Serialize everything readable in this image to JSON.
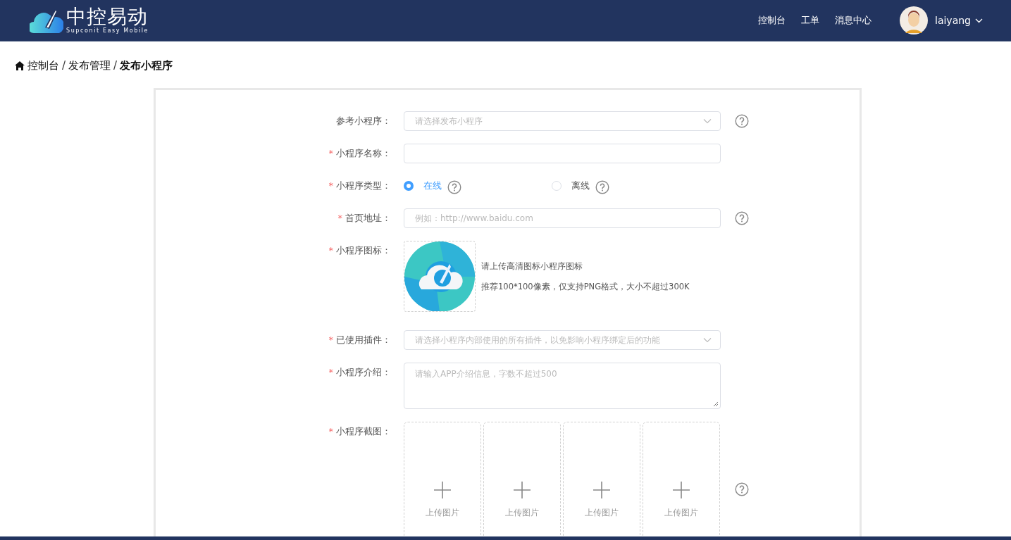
{
  "header": {
    "logo": {
      "title": "中控易动",
      "subtitle": "Supconit Easy Mobile"
    },
    "nav": [
      {
        "label": "控制台"
      },
      {
        "label": "工单"
      },
      {
        "label": "消息中心"
      }
    ],
    "user": {
      "name": "laiyang"
    }
  },
  "breadcrumb_separator": "/",
  "breadcrumb": [
    {
      "label": "控制台",
      "current": false
    },
    {
      "label": "发布管理",
      "current": false
    },
    {
      "label": "发布小程序",
      "current": true
    }
  ],
  "form": {
    "required_mark": "*",
    "fields": [
      {
        "kind": "select",
        "label": "参考小程序：",
        "required": false,
        "placeholder": "请选择发布小程序",
        "help": true
      },
      {
        "kind": "input",
        "label": "小程序名称：",
        "required": true,
        "help": false
      },
      {
        "kind": "radio",
        "label": "小程序类型：",
        "required": true,
        "options": [
          {
            "label": "在线",
            "selected": true,
            "help": true
          },
          {
            "label": "离线",
            "selected": false,
            "help": true
          }
        ]
      },
      {
        "kind": "input",
        "label": "首页地址：",
        "required": true,
        "placeholder": "例如：http://www.baidu.com",
        "help": true
      },
      {
        "kind": "icon",
        "label": "小程序图标：",
        "required": true,
        "image": {
          "kind": "picture"
        },
        "hints": [
          "请上传高清图标小程序图标",
          "推荐100*100像素，仅支持PNG格式，大小不超过300K"
        ]
      },
      {
        "kind": "select",
        "label": "已使用插件：",
        "required": true,
        "placeholder": "请选择小程序内部使用的所有插件，以免影响小程序绑定后的功能",
        "help": false
      },
      {
        "kind": "textarea",
        "label": "小程序介绍：",
        "required": true,
        "placeholder": "请输入APP介绍信息，字数不超过500"
      },
      {
        "kind": "gallery",
        "label": "小程序截图：",
        "required": true,
        "help": true,
        "slots": [
          {
            "label": "上传图片"
          },
          {
            "label": "上传图片"
          },
          {
            "label": "上传图片"
          },
          {
            "label": "上传图片"
          }
        ]
      }
    ]
  }
}
